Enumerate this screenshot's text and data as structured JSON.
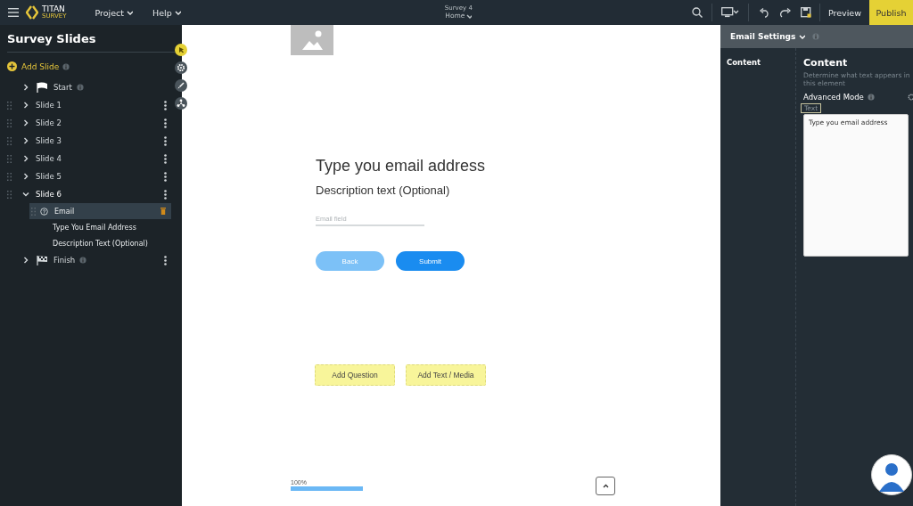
{
  "topbar": {
    "logo_title": "TITAN",
    "logo_subtitle": "SURVEY",
    "menus": [
      "Project",
      "Help"
    ],
    "document_title": "Survey 4",
    "page": "Home",
    "preview": "Preview",
    "publish": "Publish"
  },
  "sidebar": {
    "title": "Survey Slides",
    "add_slide": "Add Slide",
    "items": [
      {
        "label": "Start",
        "kind": "start",
        "expanded": false
      },
      {
        "label": "Slide 1",
        "kind": "slide",
        "expanded": false
      },
      {
        "label": "Slide 2",
        "kind": "slide",
        "expanded": false
      },
      {
        "label": "Slide 3",
        "kind": "slide",
        "expanded": false
      },
      {
        "label": "Slide 4",
        "kind": "slide",
        "expanded": false
      },
      {
        "label": "Slide 5",
        "kind": "slide",
        "expanded": false
      },
      {
        "label": "Slide 6",
        "kind": "slide",
        "expanded": true,
        "children": [
          {
            "label": "Email",
            "kind": "question",
            "selected": true
          },
          {
            "label": "Type You Email Address",
            "kind": "element",
            "selected": false
          },
          {
            "label": "Description Text (Optional)",
            "kind": "element",
            "selected": false
          }
        ]
      },
      {
        "label": "Finish",
        "kind": "finish",
        "expanded": false
      }
    ]
  },
  "canvas": {
    "question": "Type you email address",
    "description": "Description text (Optional)",
    "email_placeholder": "Email field",
    "buttons": [
      {
        "label": "Back",
        "kind": "back"
      },
      {
        "label": "Submit",
        "kind": "submit"
      }
    ],
    "add_buttons": [
      "Add Question",
      "Add Text / Media"
    ],
    "progress": {
      "label": "100%",
      "level": 1
    }
  },
  "settings": {
    "title": "Email Settings",
    "tabs": [
      "Content"
    ],
    "heading": "Content",
    "hint": "Determine what text appears in this element",
    "advanced_mode": "Advanced Mode",
    "field_label": "Text",
    "value": "Type you email address"
  }
}
